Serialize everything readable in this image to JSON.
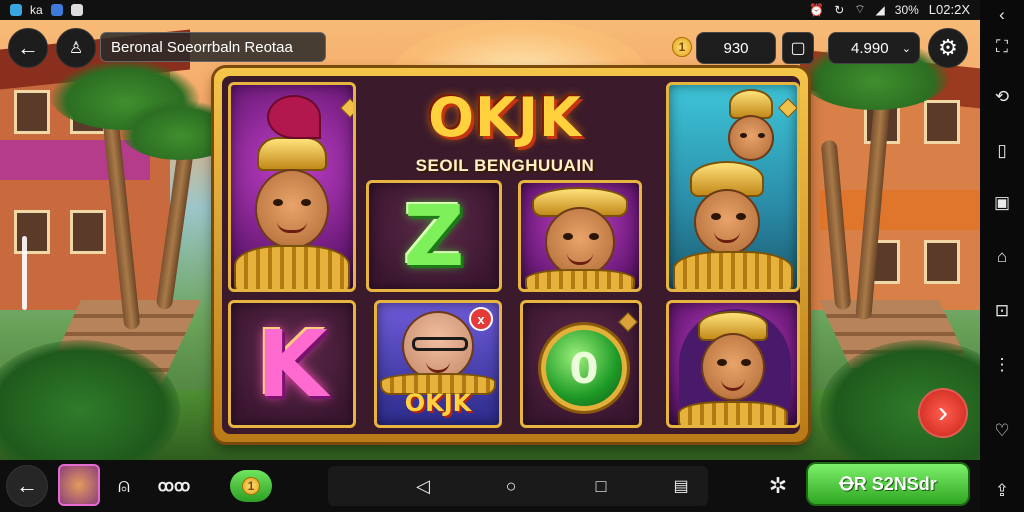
{
  "status_bar": {
    "left_label": "ka",
    "right_text": "30%",
    "clock": "L02:2X"
  },
  "top_bar": {
    "title": "Beronal Soeorrbaln Reotaa",
    "balance_left": "930",
    "balance_right": "4.990",
    "coin_symbol": "1"
  },
  "game": {
    "logo": "OKJK",
    "subtitle": "SEOIL BENGHUUAIN",
    "symbols": {
      "z_letter": "Z",
      "k_letter": "K",
      "emerald_digit": "0",
      "mini_logo": "OKJK",
      "badge": "x"
    }
  },
  "bottom_bar": {
    "counter_text": "ꝏꝏ",
    "play_label": "ꝊR S2NSdr",
    "coin_symbol": "1"
  },
  "colors": {
    "accent_gold": "#f5c54a",
    "play_green": "#2fa622",
    "next_red": "#c8231a"
  },
  "icons": [
    "back-arrow-icon",
    "user-icon",
    "coin-icon",
    "card-icon",
    "chevron-down-icon",
    "settings-icon",
    "next-arrow-icon",
    "ghost-icon",
    "puzzle-icon",
    "nav-back-icon",
    "nav-home-icon",
    "nav-recent-icon",
    "clipboard-icon"
  ]
}
